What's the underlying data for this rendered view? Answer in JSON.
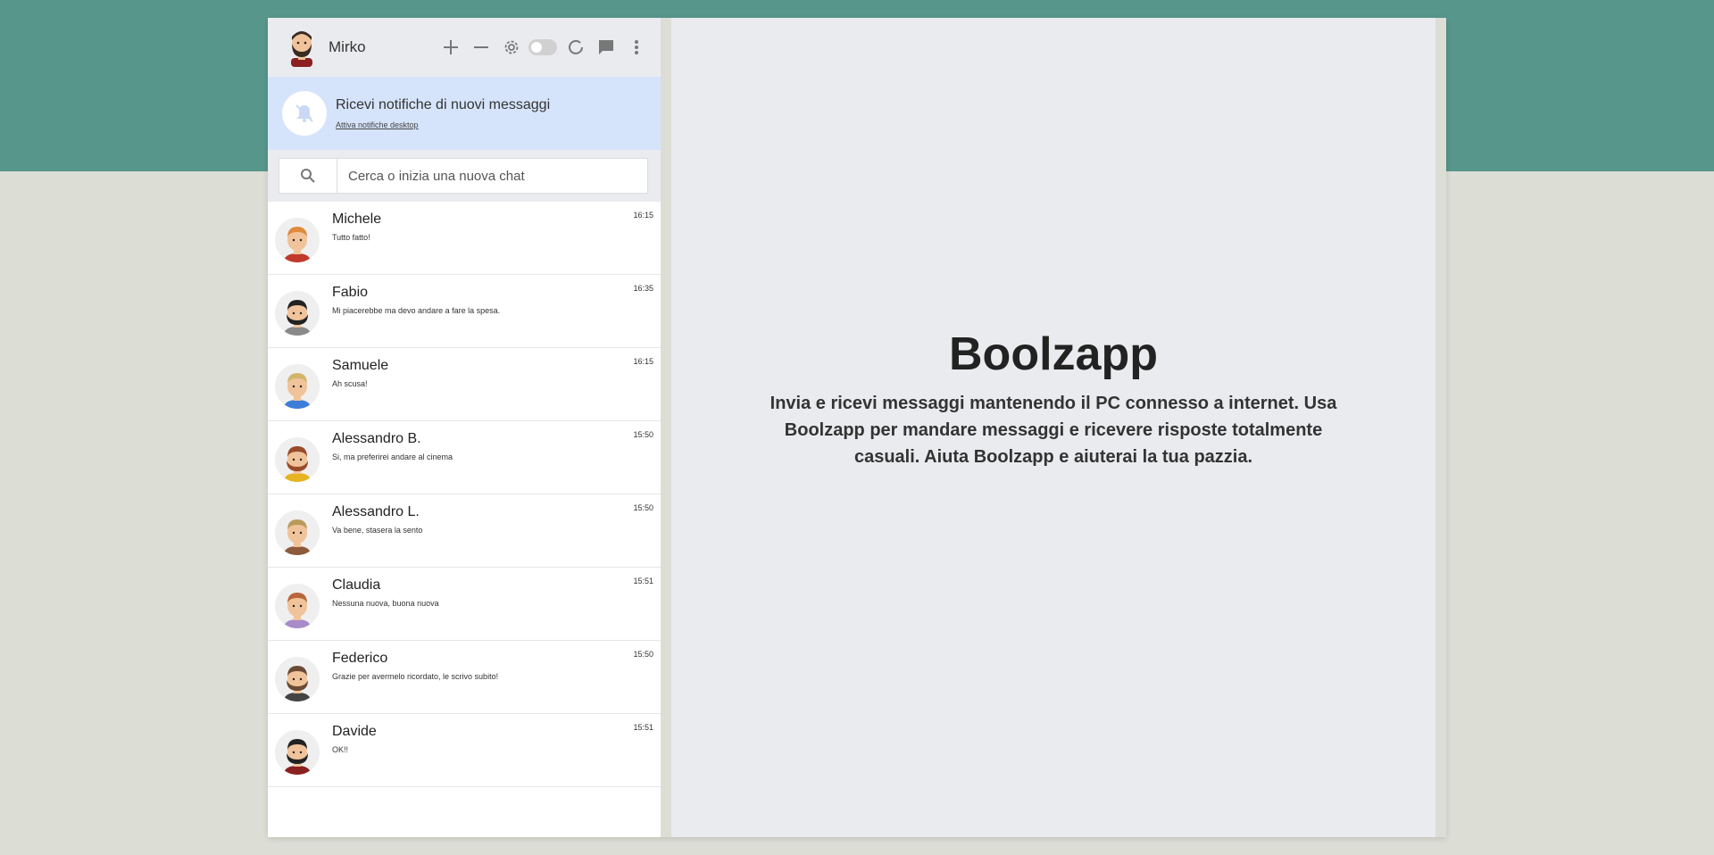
{
  "user": {
    "name": "Mirko"
  },
  "header": {
    "icons": [
      "plus-icon",
      "minus-icon",
      "gear-icon",
      "toggle-switch",
      "refresh-icon",
      "chat-icon",
      "more-icon"
    ]
  },
  "notification": {
    "title": "Ricevi notifiche di nuovi messaggi",
    "link": "Attiva notifiche desktop"
  },
  "search": {
    "placeholder": "Cerca o inizia una nuova chat"
  },
  "contacts": [
    {
      "name": "Michele",
      "last_message": "Tutto fatto!",
      "time": "16:15",
      "hair": "#e08a3c",
      "shirt": "#c0392b",
      "beard": ""
    },
    {
      "name": "Fabio",
      "last_message": "Mi piacerebbe ma devo andare a fare la spesa.",
      "time": "16:35",
      "hair": "#222222",
      "shirt": "#8a8a8a",
      "beard": "#222222"
    },
    {
      "name": "Samuele",
      "last_message": "Ah scusa!",
      "time": "16:15",
      "hair": "#d2b56a",
      "shirt": "#3b7dd8",
      "beard": ""
    },
    {
      "name": "Alessandro B.",
      "last_message": "Si, ma preferirei andare al cinema",
      "time": "15:50",
      "hair": "#9a4b2a",
      "shirt": "#e6b422",
      "beard": "#9a4b2a"
    },
    {
      "name": "Alessandro L.",
      "last_message": "Va bene, stasera la sento",
      "time": "15:50",
      "hair": "#b99a5a",
      "shirt": "#8e5a3c",
      "beard": ""
    },
    {
      "name": "Claudia",
      "last_message": "Nessuna nuova, buona nuova",
      "time": "15:51",
      "hair": "#b8653a",
      "shirt": "#a98bc9",
      "beard": ""
    },
    {
      "name": "Federico",
      "last_message": "Grazie per avermelo ricordato, le scrivo subito!",
      "time": "15:50",
      "hair": "#6b4a33",
      "shirt": "#444444",
      "beard": "#6b4a33"
    },
    {
      "name": "Davide",
      "last_message": "OK!!",
      "time": "15:51",
      "hair": "#222222",
      "shirt": "#8b2020",
      "beard": "#222222"
    }
  ],
  "main": {
    "title": "Boolzapp",
    "description": "Invia e ricevi messaggi mantenendo il PC connesso a internet. Usa Boolzapp per mandare messaggi e ricevere risposte totalmente casuali. Aiuta Boolzapp e aiuterai la tua pazzia."
  },
  "colors": {
    "top_band": "#57968b",
    "background": "#dcddd5",
    "notification_bg": "#d6e4fb",
    "panel_bg": "#eaebee"
  }
}
